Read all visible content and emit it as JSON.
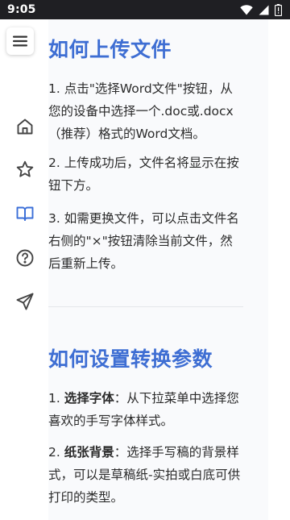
{
  "status_bar": {
    "time": "9:05",
    "icons": [
      "wifi-icon",
      "signal-icon",
      "battery-icon"
    ]
  },
  "sidebar": {
    "menu_icon": "hamburger-menu-icon",
    "items": [
      {
        "icon": "home-icon",
        "active": false
      },
      {
        "icon": "star-icon",
        "active": false
      },
      {
        "icon": "book-open-icon",
        "active": true
      },
      {
        "icon": "help-circle-icon",
        "active": false
      },
      {
        "icon": "send-icon",
        "active": false
      }
    ]
  },
  "section_upload": {
    "title": "如何上传文件",
    "steps": [
      "1. 点击\"选择Word文件\"按钮，从您的设备中选择一个.doc或.docx（推荐）格式的Word文档。",
      "2. 上传成功后，文件名将显示在按钮下方。",
      "3. 如需更换文件，可以点击文件名右侧的\"×\"按钮清除当前文件，然后重新上传。"
    ]
  },
  "section_settings": {
    "title": "如何设置转换参数",
    "steps": [
      {
        "prefix": "1. ",
        "bold": "选择字体",
        "text": "：从下拉菜单中选择您喜欢的手写字体样式。"
      },
      {
        "prefix": "2. ",
        "bold": "纸张背景",
        "text": "：选择手写稿的背景样式，可以是草稿纸-实拍或白底可供打印的类型。"
      }
    ]
  },
  "colors": {
    "accent": "#3e6ed3",
    "active_indicator": "#3b6fd8",
    "status_bar_bg": "#1f1f23",
    "content_bg": "#f9fafc"
  }
}
